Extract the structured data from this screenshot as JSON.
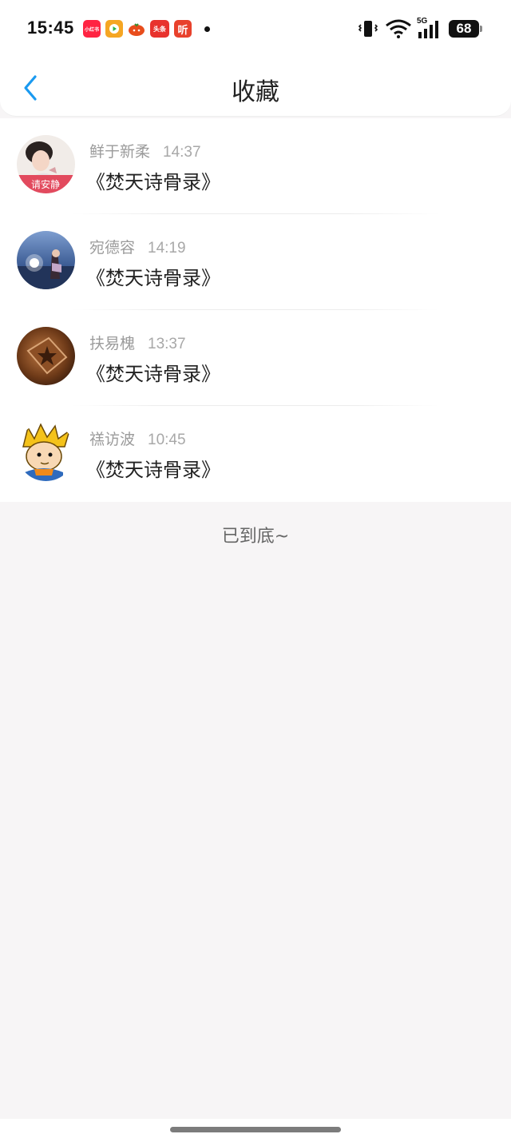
{
  "status_bar": {
    "time": "15:45",
    "app_icons": [
      {
        "name": "xiaohongshu-icon",
        "label": "小红书",
        "color": "#ff2442"
      },
      {
        "name": "video-app-icon",
        "label": "",
        "color": "#f5a623"
      },
      {
        "name": "tomato-novel-icon",
        "label": "",
        "color": "#e84d1c"
      },
      {
        "name": "toutiao-icon",
        "label": "头条",
        "color": "#e8322d"
      },
      {
        "name": "ting-icon",
        "label": "听",
        "color": "#e8412c"
      }
    ],
    "network": "5G",
    "battery": "68"
  },
  "header": {
    "title": "收藏"
  },
  "favorites": [
    {
      "user": "鲜于新柔",
      "time": "14:37",
      "book": "《焚天诗骨录》",
      "avatar": "avatar-girl-banner",
      "avatar_caption": "请安静"
    },
    {
      "user": "宛德容",
      "time": "14:19",
      "book": "《焚天诗骨录》",
      "avatar": "avatar-sparkler-night"
    },
    {
      "user": "扶易槐",
      "time": "13:37",
      "book": "《焚天诗骨录》",
      "avatar": "avatar-wood-star"
    },
    {
      "user": "禚访波",
      "time": "10:45",
      "book": "《焚天诗骨录》",
      "avatar": "avatar-cartoon-boy"
    }
  ],
  "footer_note": "已到底~",
  "colors": {
    "accent": "#1a9af0",
    "background": "#f7f5f6"
  }
}
